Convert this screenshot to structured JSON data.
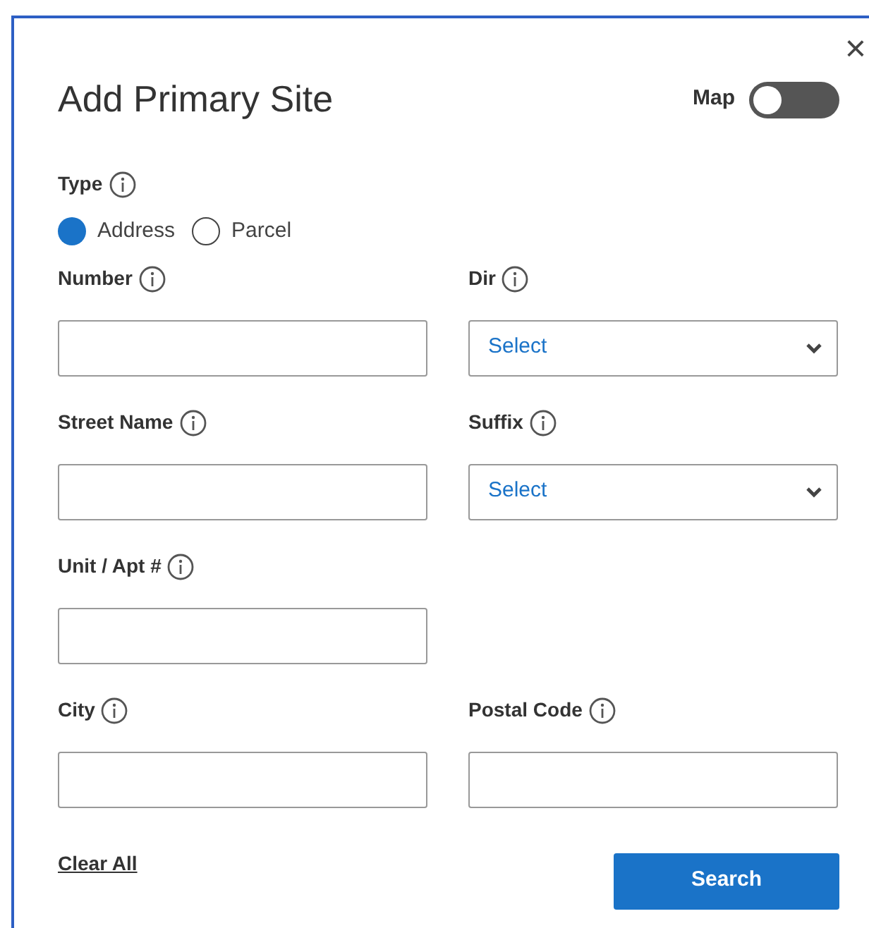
{
  "dialog": {
    "title": "Add Primary Site",
    "close": "×",
    "map_toggle": {
      "label": "Map",
      "on": false
    }
  },
  "type": {
    "label": "Type",
    "options": [
      {
        "label": "Address",
        "selected": true
      },
      {
        "label": "Parcel",
        "selected": false
      }
    ]
  },
  "rows": [
    [
      {
        "kind": "text",
        "label": "Number"
      },
      {
        "kind": "select",
        "label": "Dir",
        "value": "Select"
      }
    ],
    [
      {
        "kind": "text",
        "label": "Street Name"
      },
      {
        "kind": "select",
        "label": "Suffix",
        "value": "Select"
      }
    ],
    [
      {
        "kind": "text",
        "label": "Unit / Apt #"
      }
    ],
    [
      {
        "kind": "text",
        "label": "City"
      },
      {
        "kind": "text",
        "label": "Postal Code"
      }
    ]
  ],
  "clear_link": "Clear All",
  "search_button": "Search"
}
